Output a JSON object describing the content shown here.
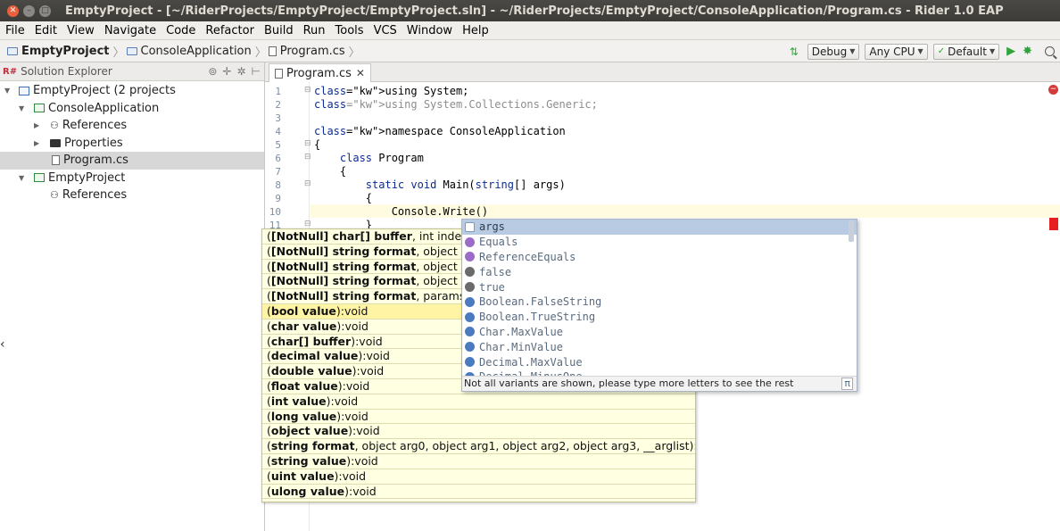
{
  "window": {
    "title": "EmptyProject - [~/RiderProjects/EmptyProject/EmptyProject.sln] - ~/RiderProjects/EmptyProject/ConsoleApplication/Program.cs - Rider 1.0 EAP"
  },
  "menu": [
    "File",
    "Edit",
    "View",
    "Navigate",
    "Code",
    "Refactor",
    "Build",
    "Run",
    "Tools",
    "VCS",
    "Window",
    "Help"
  ],
  "breadcrumb": [
    "EmptyProject",
    "ConsoleApplication",
    "Program.cs"
  ],
  "toolbar": {
    "config": "Debug",
    "platform": "Any CPU",
    "run_config": "Default"
  },
  "solution_explorer": {
    "title": "Solution Explorer",
    "items": [
      {
        "label": "EmptyProject (2 projects",
        "icon": "solution-icon"
      },
      {
        "label": "ConsoleApplication",
        "icon": "project-icon"
      },
      {
        "label": "References",
        "icon": "references-icon"
      },
      {
        "label": "Properties",
        "icon": "properties-folder-icon"
      },
      {
        "label": "Program.cs",
        "icon": "cs-file-icon"
      },
      {
        "label": "EmptyProject",
        "icon": "project-icon"
      },
      {
        "label": "References",
        "icon": "references-icon"
      }
    ]
  },
  "editor": {
    "tab": "Program.cs",
    "lines": [
      {
        "n": "1",
        "code": "using System;"
      },
      {
        "n": "2",
        "code": "using System.Collections.Generic;"
      },
      {
        "n": "3",
        "code": ""
      },
      {
        "n": "4",
        "code": "namespace ConsoleApplication"
      },
      {
        "n": "5",
        "code": "{"
      },
      {
        "n": "6",
        "code": "    class Program"
      },
      {
        "n": "7",
        "code": "    {"
      },
      {
        "n": "8",
        "code": "        static void Main(string[] args)"
      },
      {
        "n": "9",
        "code": "        {"
      },
      {
        "n": "10",
        "code": "            Console.Write()"
      },
      {
        "n": "11",
        "code": "        }"
      }
    ]
  },
  "parameter_info": [
    "([NotNull] char[] buffer, int index, i",
    "([NotNull] string format, object arg",
    "([NotNull] string format, object arg",
    "([NotNull] string format, object arg",
    "([NotNull] string format, params ob",
    "(bool value):void",
    "(char value):void",
    "(char[] buffer):void",
    "(decimal value):void",
    "(double value):void",
    "(float value):void",
    "(int value):void",
    "(long value):void",
    "(object value):void",
    "(string format, object arg0, object arg1, object arg2, object arg3, __arglist):void",
    "(string value):void",
    "(uint value):void",
    "(ulong value):void"
  ],
  "completion": {
    "items": [
      "args",
      "Equals",
      "ReferenceEquals",
      "false",
      "true",
      "Boolean.FalseString",
      "Boolean.TrueString",
      "Char.MaxValue",
      "Char.MinValue",
      "Decimal.MaxValue",
      "Decimal.MinusOne"
    ],
    "footer": "Not all variants are shown, please type more letters to see the rest",
    "pi_label": "π"
  }
}
